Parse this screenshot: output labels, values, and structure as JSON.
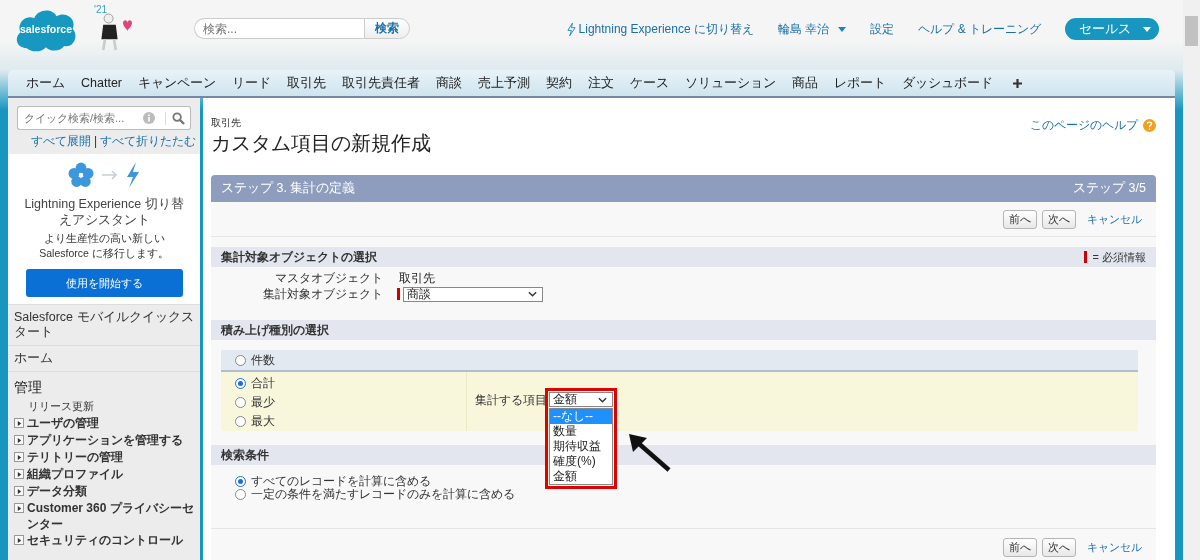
{
  "header": {
    "logo": "salesforce",
    "release_badge": "'21",
    "search": {
      "placeholder": "検索...",
      "button": "検索"
    },
    "links": [
      {
        "kind": "lightning",
        "label": "Lightning Experience に切り替え"
      },
      {
        "kind": "user",
        "label": "輪島 幸治"
      },
      {
        "kind": "plain",
        "label": "設定"
      },
      {
        "kind": "plain",
        "label": "ヘルプ & トレーニング"
      }
    ],
    "app_menu": "セールス"
  },
  "tabs": [
    {
      "label": "ホーム",
      "selected": false
    },
    {
      "label": "Chatter",
      "selected": false
    },
    {
      "label": "キャンペーン",
      "selected": false
    },
    {
      "label": "リード",
      "selected": false
    },
    {
      "label": "取引先",
      "selected": false
    },
    {
      "label": "取引先責任者",
      "selected": false
    },
    {
      "label": "商談",
      "selected": false
    },
    {
      "label": "売上予測",
      "selected": false
    },
    {
      "label": "契約",
      "selected": false
    },
    {
      "label": "注文",
      "selected": false
    },
    {
      "label": "ケース",
      "selected": false
    },
    {
      "label": "ソリューション",
      "selected": false
    },
    {
      "label": "商品",
      "selected": false
    },
    {
      "label": "レポート",
      "selected": false
    },
    {
      "label": "ダッシュボード",
      "selected": false
    }
  ],
  "sidebar": {
    "quick_search": {
      "placeholder": "クイック検索/検索..."
    },
    "expand_all": "すべて展開",
    "separator": "|",
    "collapse_all": "すべて折りたたむ",
    "assistant": {
      "title": "Lightning Experience 切り替えアシスタント",
      "description": "より生産性の高い新しい Salesforce に移行します。",
      "button": "使用を開始する"
    },
    "sections": [
      {
        "label": "Salesforce モバイルクイックスタート"
      },
      {
        "label": "ホーム"
      },
      {
        "label": "管理",
        "items": [
          {
            "kind": "link",
            "label": "リリース更新"
          },
          {
            "kind": "node",
            "label": "ユーザの管理",
            "expanded": false
          },
          {
            "kind": "node",
            "label": "アプリケーションを管理する",
            "expanded": false
          },
          {
            "kind": "node",
            "label": "テリトリーの管理",
            "expanded": false
          },
          {
            "kind": "node",
            "label": "組織プロファイル",
            "expanded": false
          },
          {
            "kind": "node",
            "label": "データ分類",
            "expanded": false
          },
          {
            "kind": "node",
            "label": "Customer 360 プライバシーセンター",
            "expanded": false
          },
          {
            "kind": "node",
            "label": "セキュリティのコントロール",
            "expanded": false
          }
        ]
      }
    ]
  },
  "content": {
    "breadcrumb": "取引先",
    "title": "カスタム項目の新規作成",
    "help_link": "このページのヘルプ",
    "step": {
      "title": "ステップ 3. 集計の定義",
      "counter": "ステップ 3/5",
      "buttons": [
        "前へ",
        "次へ"
      ],
      "cancel": "キャンセル",
      "sections": [
        {
          "kind": "object",
          "title": "集計対象オブジェクトの選択",
          "required_legend": "= 必須情報",
          "fields": [
            {
              "label": "マスタオブジェクト",
              "value": "取引先",
              "kind": "text",
              "required": false
            },
            {
              "label": "集計対象オブジェクト",
              "value": "商談",
              "kind": "select",
              "required": true
            }
          ]
        },
        {
          "kind": "rollup",
          "title": "積み上げ種別の選択",
          "options": [
            {
              "label": "件数",
              "selected": false
            },
            {
              "label": "合計",
              "selected": true
            },
            {
              "label": "最少",
              "selected": false
            },
            {
              "label": "最大",
              "selected": false
            }
          ],
          "field_label": "集計する項目",
          "field_value": "金額",
          "dropdown": [
            {
              "label": "--なし--",
              "selected": true
            },
            {
              "label": "数量",
              "selected": false
            },
            {
              "label": "期待収益",
              "selected": false
            },
            {
              "label": "確度(%)",
              "selected": false
            },
            {
              "label": "金額",
              "selected": false
            }
          ]
        },
        {
          "kind": "filter",
          "title": "検索条件",
          "options": [
            {
              "label": "すべてのレコードを計算に含める",
              "selected": true
            },
            {
              "label": "一定の条件を満たすレコードのみを計算に含める",
              "selected": false
            }
          ]
        }
      ],
      "bottom_buttons": [
        "前へ",
        "次へ"
      ],
      "bottom_cancel": "キャンセル"
    }
  }
}
